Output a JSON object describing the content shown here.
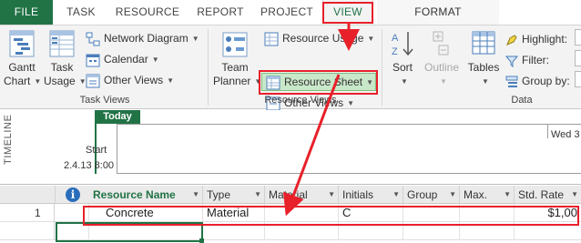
{
  "tabs": {
    "file": "FILE",
    "items": [
      {
        "label": "TASK",
        "active": false
      },
      {
        "label": "RESOURCE",
        "active": false
      },
      {
        "label": "REPORT",
        "active": false
      },
      {
        "label": "PROJECT",
        "active": false
      },
      {
        "label": "VIEW",
        "active": true
      },
      {
        "label": "FORMAT",
        "active": false
      }
    ]
  },
  "ribbon": {
    "task_views": {
      "label": "Task Views",
      "gantt_chart": {
        "line1": "Gantt",
        "line2": "Chart"
      },
      "task_usage": {
        "line1": "Task",
        "line2": "Usage"
      },
      "network_diagram": "Network Diagram",
      "calendar": "Calendar",
      "other_views": "Other Views"
    },
    "resource_views": {
      "label": "Resource Views",
      "team_planner": {
        "line1": "Team",
        "line2": "Planner"
      },
      "resource_usage": "Resource Usage",
      "resource_sheet": "Resource Sheet",
      "other_views": "Other Views"
    },
    "data": {
      "label": "Data",
      "sort": "Sort",
      "outline": "Outline",
      "tables": "Tables",
      "highlight": "Highlight:",
      "filter": "Filter:",
      "group_by": "Group by:"
    }
  },
  "timeline": {
    "label": "TIMELINE",
    "today": "Today",
    "start_label": "Start",
    "start_date": "2.4.13 8:00",
    "tick_label": "Wed 3"
  },
  "grid": {
    "columns": [
      "Resource Name",
      "Type",
      "Material",
      "Initials",
      "Group",
      "Max.",
      "Std. Rate"
    ],
    "rows": [
      {
        "num": "1",
        "name": "Concrete",
        "type": "Material",
        "material": "",
        "initials": "C",
        "group": "",
        "max": "",
        "std_rate": "$1,00"
      }
    ]
  },
  "colors": {
    "accent": "#217346",
    "annotation": "#e8202a",
    "highlight_button": "#c9e7c9"
  }
}
